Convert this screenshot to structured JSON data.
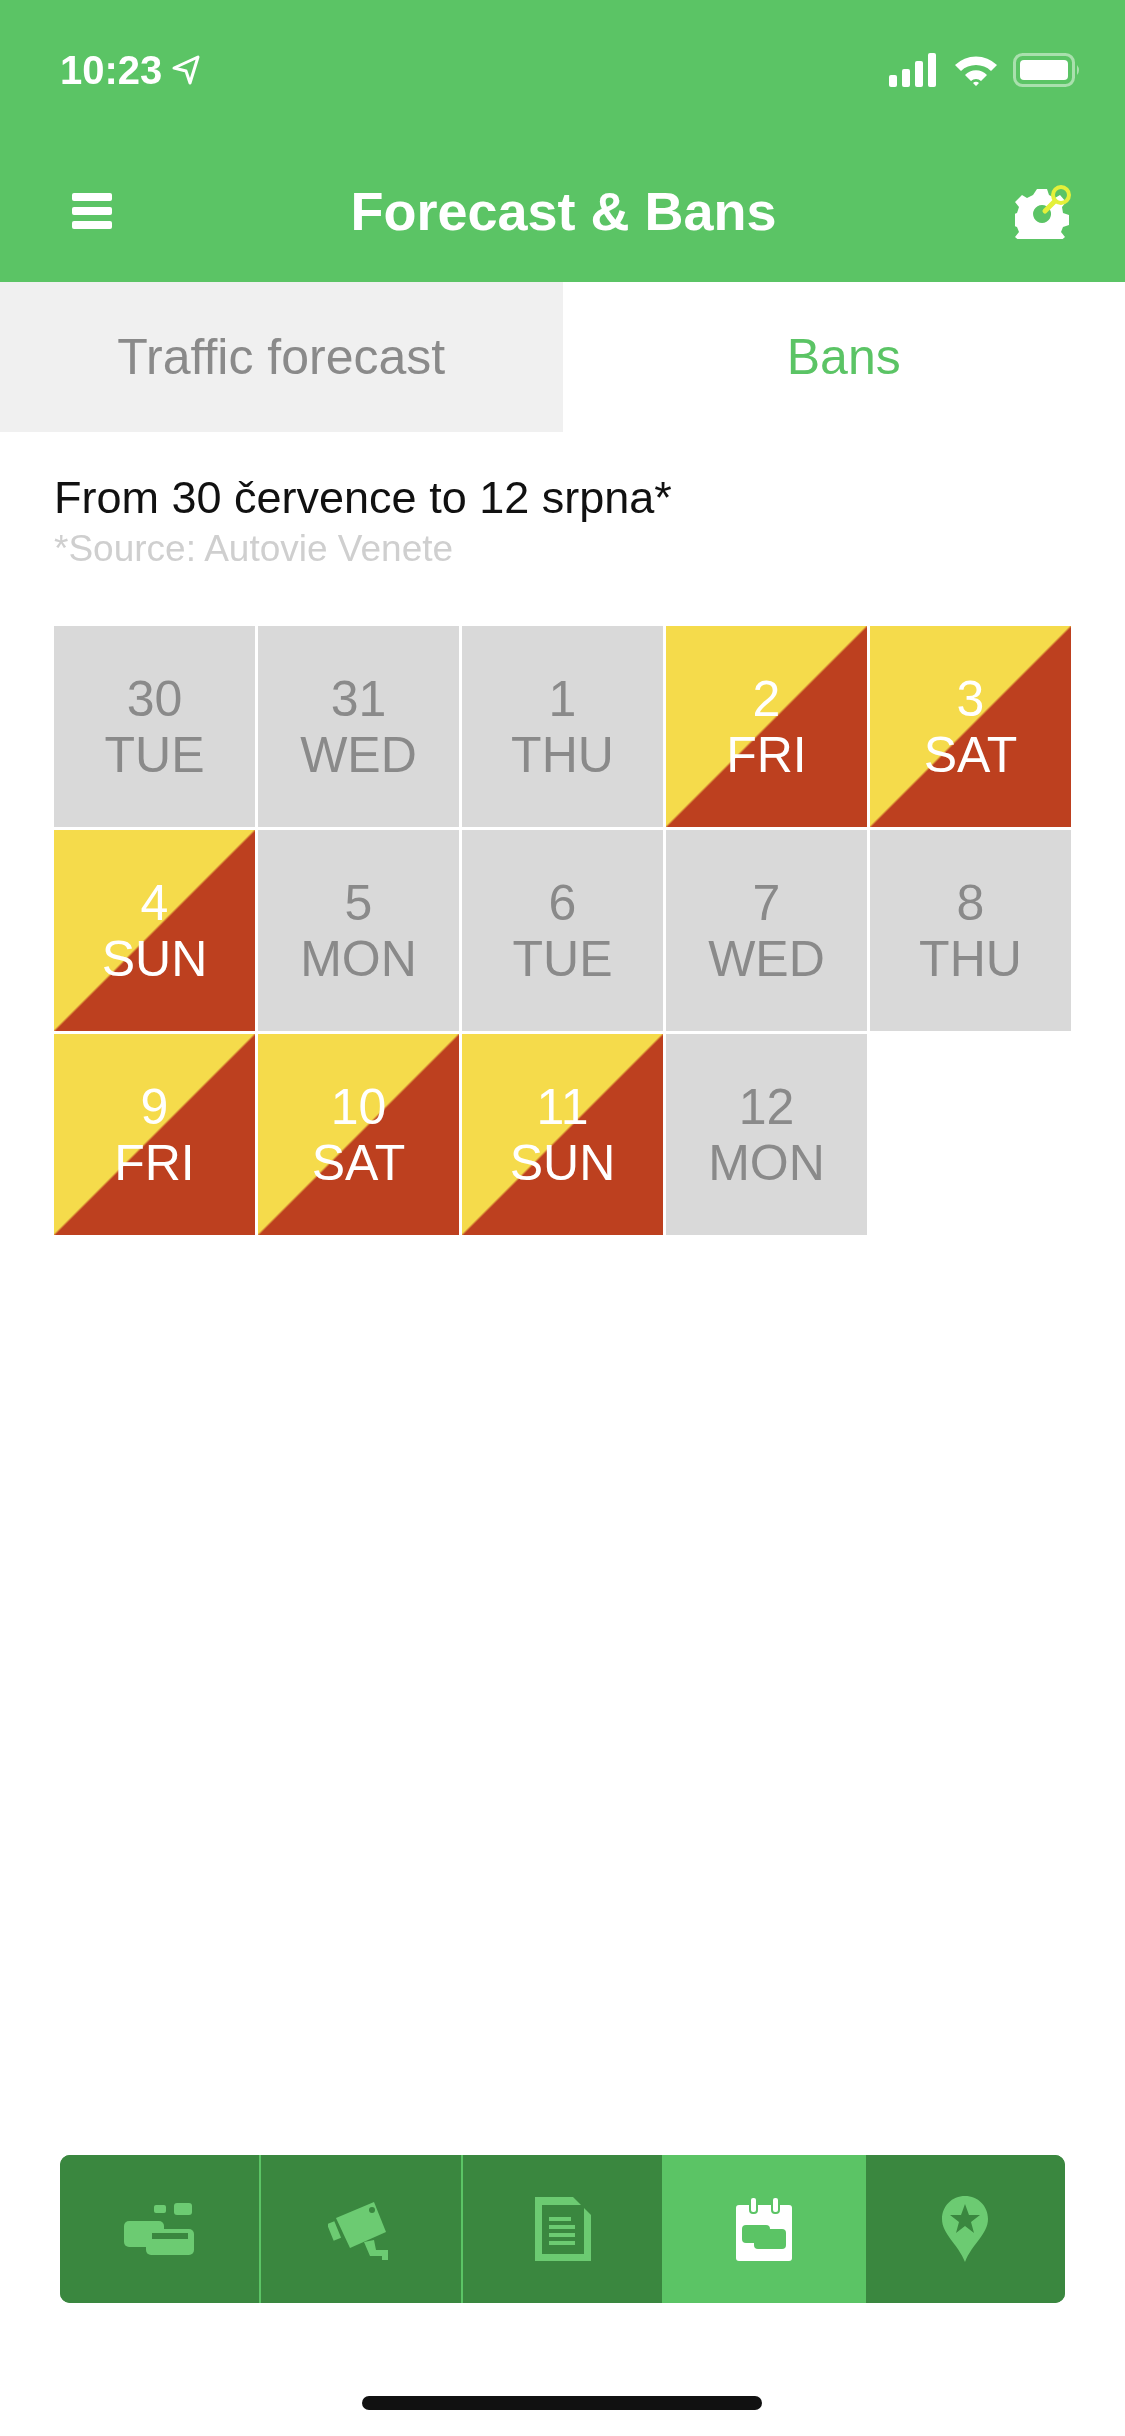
{
  "status_bar": {
    "time": "10:23"
  },
  "header": {
    "title": "Forecast & Bans"
  },
  "tabs": [
    {
      "label": "Traffic forecast",
      "selected": false
    },
    {
      "label": "Bans",
      "selected": true
    }
  ],
  "period": {
    "title": "From 30 července to 12 srpna*",
    "source": "*Source: Autovie Venete"
  },
  "days": [
    {
      "day": "30",
      "weekday": "TUE",
      "kind": "free"
    },
    {
      "day": "31",
      "weekday": "WED",
      "kind": "free"
    },
    {
      "day": "1",
      "weekday": "THU",
      "kind": "free"
    },
    {
      "day": "2",
      "weekday": "FRI",
      "kind": "ban"
    },
    {
      "day": "3",
      "weekday": "SAT",
      "kind": "ban"
    },
    {
      "day": "4",
      "weekday": "SUN",
      "kind": "ban"
    },
    {
      "day": "5",
      "weekday": "MON",
      "kind": "free"
    },
    {
      "day": "6",
      "weekday": "TUE",
      "kind": "free"
    },
    {
      "day": "7",
      "weekday": "WED",
      "kind": "free"
    },
    {
      "day": "8",
      "weekday": "THU",
      "kind": "free"
    },
    {
      "day": "9",
      "weekday": "FRI",
      "kind": "ban"
    },
    {
      "day": "10",
      "weekday": "SAT",
      "kind": "ban"
    },
    {
      "day": "11",
      "weekday": "SUN",
      "kind": "ban"
    },
    {
      "day": "12",
      "weekday": "MON",
      "kind": "free"
    }
  ],
  "bottom_nav": [
    {
      "kind": "traffic",
      "selected": false
    },
    {
      "kind": "camera",
      "selected": false
    },
    {
      "kind": "document",
      "selected": false
    },
    {
      "kind": "calendar",
      "selected": true
    },
    {
      "kind": "places",
      "selected": false
    }
  ]
}
